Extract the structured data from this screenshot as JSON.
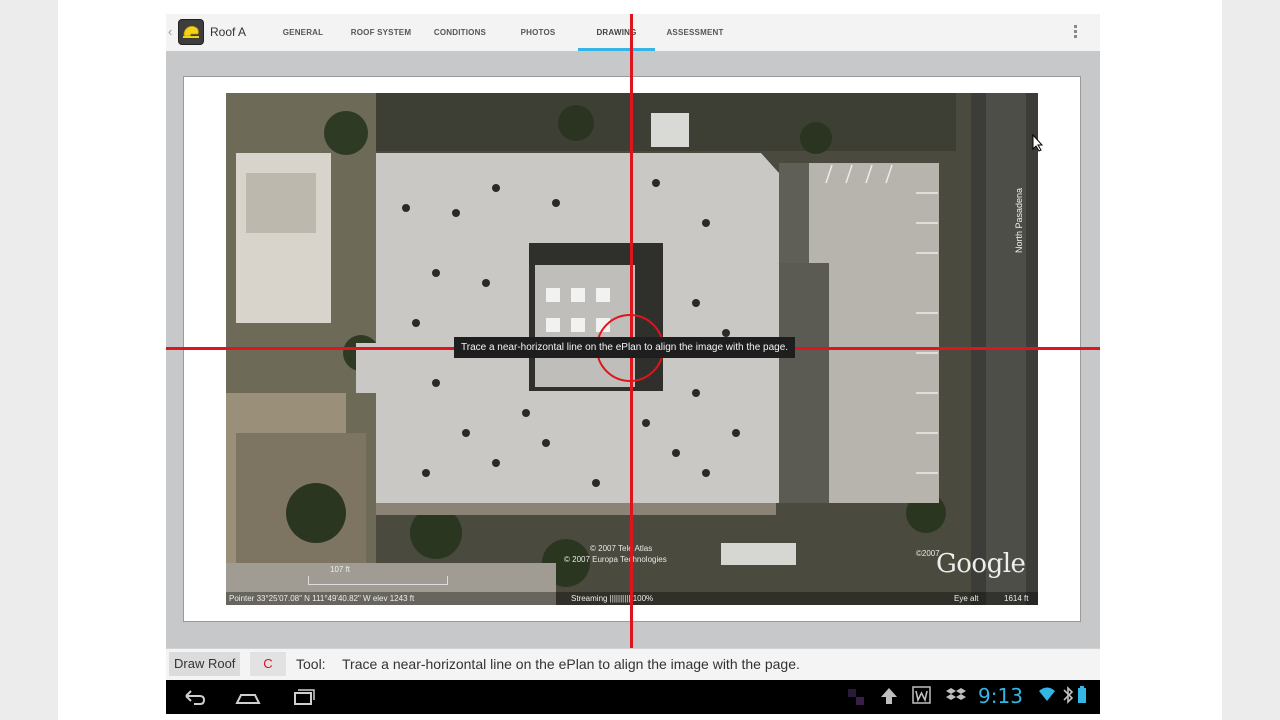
{
  "app": {
    "title": "Roof A",
    "back_glyph": "‹",
    "icon": "helmet-logo-icon"
  },
  "tabs": [
    {
      "label": "GENERAL",
      "active": false
    },
    {
      "label": "ROOF SYSTEM",
      "active": false
    },
    {
      "label": "CONDITIONS",
      "active": false
    },
    {
      "label": "PHOTOS",
      "active": false
    },
    {
      "label": "DRAWING",
      "active": true
    },
    {
      "label": "ASSESSMENT",
      "active": false
    }
  ],
  "overflow_icon": "overflow-menu-icon",
  "map": {
    "street_label": "North Pasadena",
    "copyright_1": "© 2007 Tele Atlas",
    "copyright_2": "© 2007 Europa Technologies",
    "google_logo": "Google",
    "google_year": "©2007",
    "scale": "107 ft",
    "pointer": "Pointer  33°25'07.08\" N    111°49'40.82\" W  elev  1243 ft",
    "streaming": "Streaming |||||||||| 100%",
    "eye_alt": "Eye alt",
    "eye_alt_value": "1614 ft"
  },
  "tooltip": "Trace a near-horizontal line on the ePlan to align the image with the page.",
  "toolbar": {
    "draw_roof_label": "Draw Roof",
    "c_label": "C",
    "tool_label": "Tool:",
    "tool_instruction": "Trace a near-horizontal line on the ePlan to align the image with the page."
  },
  "system": {
    "clock": "9:13",
    "nav_icons": [
      "back-icon",
      "home-icon",
      "recent-apps-icon"
    ],
    "status_icons": [
      "upload-icon",
      "word-icon",
      "dropbox-icon",
      "wifi-icon",
      "bluetooth-icon",
      "battery-icon"
    ]
  },
  "colors": {
    "accent": "#35b5e5",
    "crosshair": "#e0141c",
    "clock": "#33b5e5"
  }
}
